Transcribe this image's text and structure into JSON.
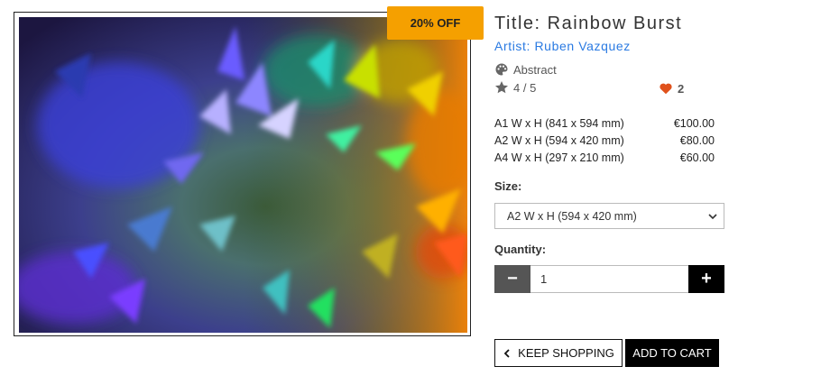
{
  "product": {
    "badge": "20% OFF",
    "title": "Title: Rainbow Burst",
    "artist": "Artist: Ruben Vazquez",
    "category": "Abstract",
    "rating": "4 / 5",
    "likes": "2"
  },
  "prices": [
    {
      "size": "A1 W x H (841 x 594 mm)",
      "price": "€100.00"
    },
    {
      "size": "A2 W x H (594 x 420 mm)",
      "price": "€80.00"
    },
    {
      "size": "A4 W x H (297 x 210 mm)",
      "price": "€60.00"
    }
  ],
  "form": {
    "size_label": "Size:",
    "size_selected": "A2 W x H (594 x 420 mm)",
    "quantity_label": "Quantity:",
    "quantity_value": "1",
    "minus": "−",
    "plus": "+"
  },
  "actions": {
    "keep_shopping": "KEEP SHOPPING",
    "add_to_cart": "ADD TO CART"
  },
  "icons": {
    "category": "palette-icon",
    "rating": "star-icon",
    "likes": "heart-icon",
    "back": "chevron-left-icon",
    "select": "chevron-down-icon"
  },
  "colors": {
    "badge": "#f5a000",
    "artist_link": "#2a7ae2",
    "heart": "#e0521c"
  }
}
